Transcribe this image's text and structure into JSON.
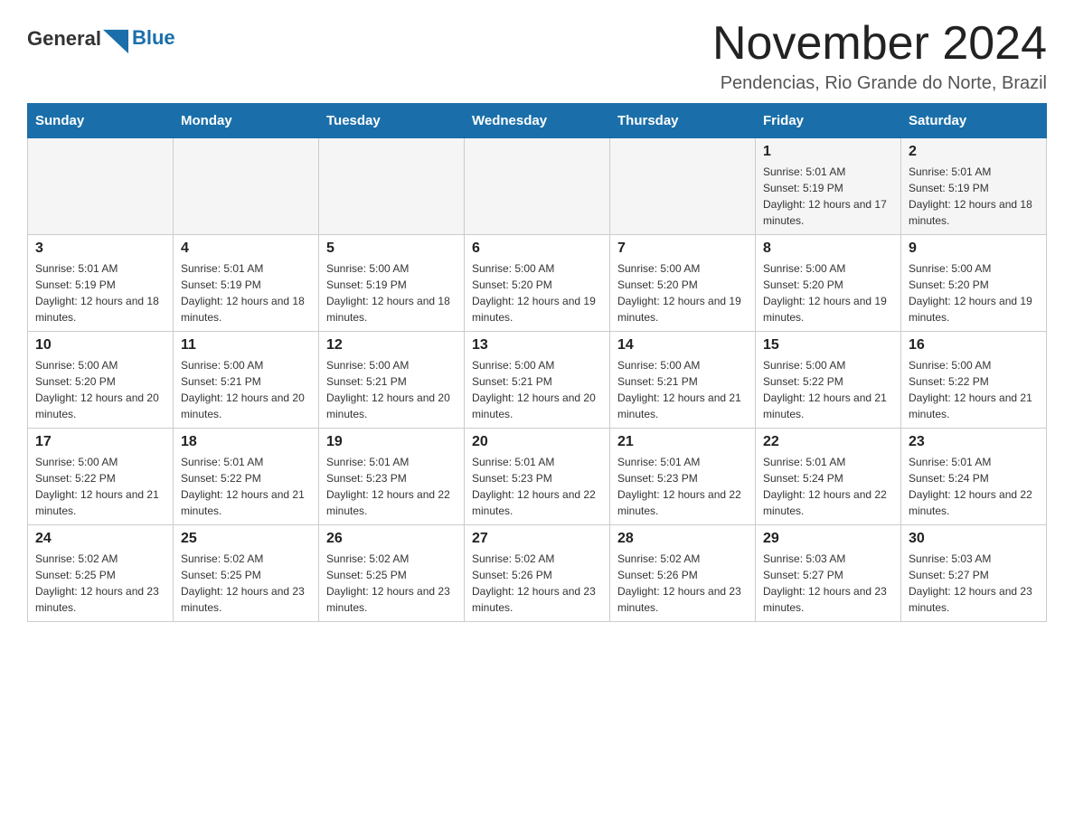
{
  "header": {
    "logo": {
      "text_general": "General",
      "text_blue": "Blue"
    },
    "title": "November 2024",
    "location": "Pendencias, Rio Grande do Norte, Brazil"
  },
  "days_of_week": [
    "Sunday",
    "Monday",
    "Tuesday",
    "Wednesday",
    "Thursday",
    "Friday",
    "Saturday"
  ],
  "weeks": [
    [
      {
        "day": "",
        "sunrise": "",
        "sunset": "",
        "daylight": ""
      },
      {
        "day": "",
        "sunrise": "",
        "sunset": "",
        "daylight": ""
      },
      {
        "day": "",
        "sunrise": "",
        "sunset": "",
        "daylight": ""
      },
      {
        "day": "",
        "sunrise": "",
        "sunset": "",
        "daylight": ""
      },
      {
        "day": "",
        "sunrise": "",
        "sunset": "",
        "daylight": ""
      },
      {
        "day": "1",
        "sunrise": "Sunrise: 5:01 AM",
        "sunset": "Sunset: 5:19 PM",
        "daylight": "Daylight: 12 hours and 17 minutes."
      },
      {
        "day": "2",
        "sunrise": "Sunrise: 5:01 AM",
        "sunset": "Sunset: 5:19 PM",
        "daylight": "Daylight: 12 hours and 18 minutes."
      }
    ],
    [
      {
        "day": "3",
        "sunrise": "Sunrise: 5:01 AM",
        "sunset": "Sunset: 5:19 PM",
        "daylight": "Daylight: 12 hours and 18 minutes."
      },
      {
        "day": "4",
        "sunrise": "Sunrise: 5:01 AM",
        "sunset": "Sunset: 5:19 PM",
        "daylight": "Daylight: 12 hours and 18 minutes."
      },
      {
        "day": "5",
        "sunrise": "Sunrise: 5:00 AM",
        "sunset": "Sunset: 5:19 PM",
        "daylight": "Daylight: 12 hours and 18 minutes."
      },
      {
        "day": "6",
        "sunrise": "Sunrise: 5:00 AM",
        "sunset": "Sunset: 5:20 PM",
        "daylight": "Daylight: 12 hours and 19 minutes."
      },
      {
        "day": "7",
        "sunrise": "Sunrise: 5:00 AM",
        "sunset": "Sunset: 5:20 PM",
        "daylight": "Daylight: 12 hours and 19 minutes."
      },
      {
        "day": "8",
        "sunrise": "Sunrise: 5:00 AM",
        "sunset": "Sunset: 5:20 PM",
        "daylight": "Daylight: 12 hours and 19 minutes."
      },
      {
        "day": "9",
        "sunrise": "Sunrise: 5:00 AM",
        "sunset": "Sunset: 5:20 PM",
        "daylight": "Daylight: 12 hours and 19 minutes."
      }
    ],
    [
      {
        "day": "10",
        "sunrise": "Sunrise: 5:00 AM",
        "sunset": "Sunset: 5:20 PM",
        "daylight": "Daylight: 12 hours and 20 minutes."
      },
      {
        "day": "11",
        "sunrise": "Sunrise: 5:00 AM",
        "sunset": "Sunset: 5:21 PM",
        "daylight": "Daylight: 12 hours and 20 minutes."
      },
      {
        "day": "12",
        "sunrise": "Sunrise: 5:00 AM",
        "sunset": "Sunset: 5:21 PM",
        "daylight": "Daylight: 12 hours and 20 minutes."
      },
      {
        "day": "13",
        "sunrise": "Sunrise: 5:00 AM",
        "sunset": "Sunset: 5:21 PM",
        "daylight": "Daylight: 12 hours and 20 minutes."
      },
      {
        "day": "14",
        "sunrise": "Sunrise: 5:00 AM",
        "sunset": "Sunset: 5:21 PM",
        "daylight": "Daylight: 12 hours and 21 minutes."
      },
      {
        "day": "15",
        "sunrise": "Sunrise: 5:00 AM",
        "sunset": "Sunset: 5:22 PM",
        "daylight": "Daylight: 12 hours and 21 minutes."
      },
      {
        "day": "16",
        "sunrise": "Sunrise: 5:00 AM",
        "sunset": "Sunset: 5:22 PM",
        "daylight": "Daylight: 12 hours and 21 minutes."
      }
    ],
    [
      {
        "day": "17",
        "sunrise": "Sunrise: 5:00 AM",
        "sunset": "Sunset: 5:22 PM",
        "daylight": "Daylight: 12 hours and 21 minutes."
      },
      {
        "day": "18",
        "sunrise": "Sunrise: 5:01 AM",
        "sunset": "Sunset: 5:22 PM",
        "daylight": "Daylight: 12 hours and 21 minutes."
      },
      {
        "day": "19",
        "sunrise": "Sunrise: 5:01 AM",
        "sunset": "Sunset: 5:23 PM",
        "daylight": "Daylight: 12 hours and 22 minutes."
      },
      {
        "day": "20",
        "sunrise": "Sunrise: 5:01 AM",
        "sunset": "Sunset: 5:23 PM",
        "daylight": "Daylight: 12 hours and 22 minutes."
      },
      {
        "day": "21",
        "sunrise": "Sunrise: 5:01 AM",
        "sunset": "Sunset: 5:23 PM",
        "daylight": "Daylight: 12 hours and 22 minutes."
      },
      {
        "day": "22",
        "sunrise": "Sunrise: 5:01 AM",
        "sunset": "Sunset: 5:24 PM",
        "daylight": "Daylight: 12 hours and 22 minutes."
      },
      {
        "day": "23",
        "sunrise": "Sunrise: 5:01 AM",
        "sunset": "Sunset: 5:24 PM",
        "daylight": "Daylight: 12 hours and 22 minutes."
      }
    ],
    [
      {
        "day": "24",
        "sunrise": "Sunrise: 5:02 AM",
        "sunset": "Sunset: 5:25 PM",
        "daylight": "Daylight: 12 hours and 23 minutes."
      },
      {
        "day": "25",
        "sunrise": "Sunrise: 5:02 AM",
        "sunset": "Sunset: 5:25 PM",
        "daylight": "Daylight: 12 hours and 23 minutes."
      },
      {
        "day": "26",
        "sunrise": "Sunrise: 5:02 AM",
        "sunset": "Sunset: 5:25 PM",
        "daylight": "Daylight: 12 hours and 23 minutes."
      },
      {
        "day": "27",
        "sunrise": "Sunrise: 5:02 AM",
        "sunset": "Sunset: 5:26 PM",
        "daylight": "Daylight: 12 hours and 23 minutes."
      },
      {
        "day": "28",
        "sunrise": "Sunrise: 5:02 AM",
        "sunset": "Sunset: 5:26 PM",
        "daylight": "Daylight: 12 hours and 23 minutes."
      },
      {
        "day": "29",
        "sunrise": "Sunrise: 5:03 AM",
        "sunset": "Sunset: 5:27 PM",
        "daylight": "Daylight: 12 hours and 23 minutes."
      },
      {
        "day": "30",
        "sunrise": "Sunrise: 5:03 AM",
        "sunset": "Sunset: 5:27 PM",
        "daylight": "Daylight: 12 hours and 23 minutes."
      }
    ]
  ]
}
